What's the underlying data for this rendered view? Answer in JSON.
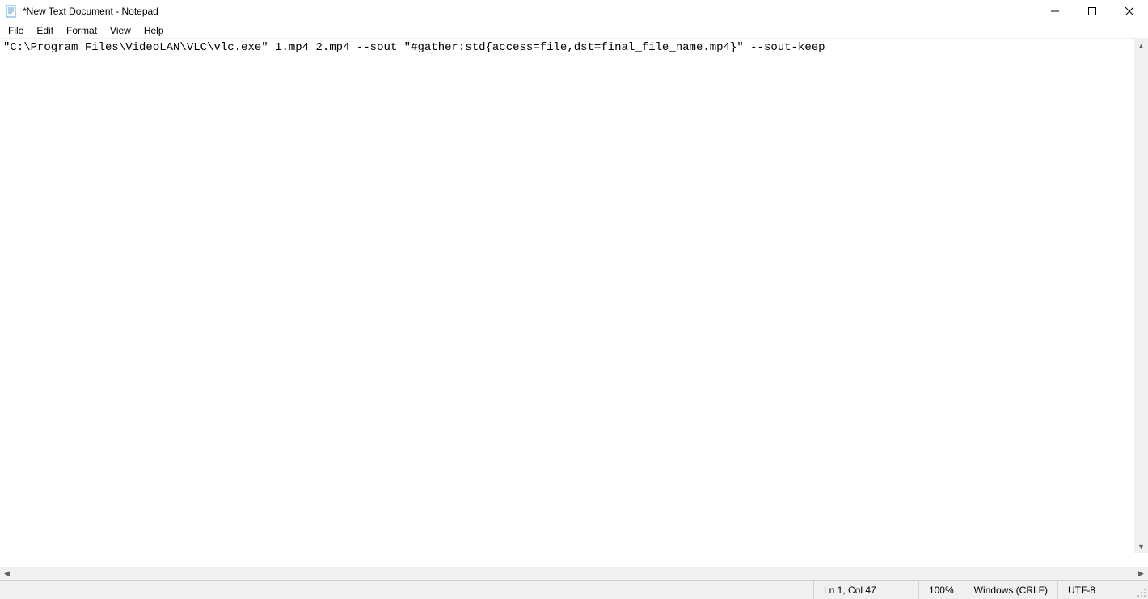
{
  "titlebar": {
    "title": "*New Text Document - Notepad"
  },
  "menubar": {
    "file": "File",
    "edit": "Edit",
    "format": "Format",
    "view": "View",
    "help": "Help"
  },
  "editor": {
    "content": "\"C:\\Program Files\\VideoLAN\\VLC\\vlc.exe\" 1.mp4 2.mp4 --sout \"#gather:std{access=file,dst=final_file_name.mp4}\" --sout-keep"
  },
  "statusbar": {
    "position": "Ln 1, Col 47",
    "zoom": "100%",
    "line_ending": "Windows (CRLF)",
    "encoding": "UTF-8"
  }
}
